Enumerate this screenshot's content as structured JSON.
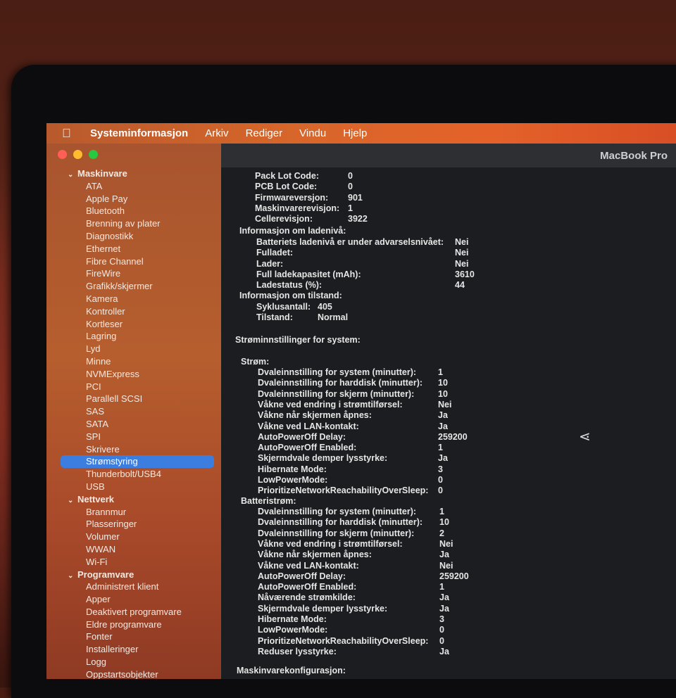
{
  "menubar": {
    "app_name": "Systeminformasjon",
    "items": [
      "Arkiv",
      "Rediger",
      "Vindu",
      "Hjelp"
    ]
  },
  "window": {
    "title": "MacBook Pro"
  },
  "sidebar": {
    "groups": [
      {
        "label": "Maskinvare",
        "items": [
          "ATA",
          "Apple Pay",
          "Bluetooth",
          "Brenning av plater",
          "Diagnostikk",
          "Ethernet",
          "Fibre Channel",
          "FireWire",
          "Grafikk/skjermer",
          "Kamera",
          "Kontroller",
          "Kortleser",
          "Lagring",
          "Lyd",
          "Minne",
          "NVMExpress",
          "PCI",
          "Parallell SCSI",
          "SAS",
          "SATA",
          "SPI",
          "Skrivere",
          "Strømstyring",
          "Thunderbolt/USB4",
          "USB"
        ]
      },
      {
        "label": "Nettverk",
        "items": [
          "Brannmur",
          "Plasseringer",
          "Volumer",
          "WWAN",
          "Wi-Fi"
        ]
      },
      {
        "label": "Programvare",
        "items": [
          "Administrert klient",
          "Apper",
          "Deaktivert programvare",
          "Eldre programvare",
          "Fonter",
          "Installeringer",
          "Logg",
          "Oppstartsobjekter"
        ]
      }
    ],
    "selected": "Strømstyring"
  },
  "content": {
    "battery_model": [
      {
        "label": "Pack Lot Code:",
        "value": "0"
      },
      {
        "label": "PCB Lot Code:",
        "value": "0"
      },
      {
        "label": "Firmwareversjon:",
        "value": "901"
      },
      {
        "label": "Maskinvarerevisjon:",
        "value": "1"
      },
      {
        "label": "Cellerevisjon:",
        "value": "3922"
      }
    ],
    "charge_header": "Informasjon om ladenivå:",
    "charge": [
      {
        "label": "Batteriets ladenivå er under advarselsnivået:",
        "value": "Nei"
      },
      {
        "label": "Fulladet:",
        "value": "Nei"
      },
      {
        "label": "Lader:",
        "value": "Nei"
      },
      {
        "label": "Full ladekapasitet (mAh):",
        "value": "3610"
      },
      {
        "label": "Ladestatus (%):",
        "value": "44"
      }
    ],
    "health_header": "Informasjon om tilstand:",
    "health": [
      {
        "label": "Syklusantall:",
        "value": "405"
      },
      {
        "label": "Tilstand:",
        "value": "Normal"
      }
    ],
    "system_header": "Strøminnstillinger for system:",
    "ac_header": "Strøm:",
    "ac": [
      {
        "label": "Dvaleinnstilling for system (minutter):",
        "value": "1"
      },
      {
        "label": "Dvaleinnstilling for harddisk (minutter):",
        "value": "10"
      },
      {
        "label": "Dvaleinnstilling for skjerm (minutter):",
        "value": "10"
      },
      {
        "label": "Våkne ved endring i strømtilførsel:",
        "value": "Nei"
      },
      {
        "label": "Våkne når skjermen åpnes:",
        "value": "Ja"
      },
      {
        "label": "Våkne ved LAN-kontakt:",
        "value": "Ja"
      },
      {
        "label": "AutoPowerOff Delay:",
        "value": "259200"
      },
      {
        "label": "AutoPowerOff Enabled:",
        "value": "1"
      },
      {
        "label": "Skjermdvale demper lysstyrke:",
        "value": "Ja"
      },
      {
        "label": "Hibernate Mode:",
        "value": "3"
      },
      {
        "label": "LowPowerMode:",
        "value": "0"
      },
      {
        "label": "PrioritizeNetworkReachabilityOverSleep:",
        "value": "0"
      }
    ],
    "battery_header": "Batteristrøm:",
    "battery": [
      {
        "label": "Dvaleinnstilling for system (minutter):",
        "value": "1"
      },
      {
        "label": "Dvaleinnstilling for harddisk (minutter):",
        "value": "10"
      },
      {
        "label": "Dvaleinnstilling for skjerm (minutter):",
        "value": "2"
      },
      {
        "label": "Våkne ved endring i strømtilførsel:",
        "value": "Nei"
      },
      {
        "label": "Våkne når skjermen åpnes:",
        "value": "Ja"
      },
      {
        "label": "Våkne ved LAN-kontakt:",
        "value": "Nei"
      },
      {
        "label": "AutoPowerOff Delay:",
        "value": "259200"
      },
      {
        "label": "AutoPowerOff Enabled:",
        "value": "1"
      },
      {
        "label": "Nåværende strømkilde:",
        "value": "Ja"
      },
      {
        "label": "Skjermdvale demper lysstyrke:",
        "value": "Ja"
      },
      {
        "label": "Hibernate Mode:",
        "value": "3"
      },
      {
        "label": "LowPowerMode:",
        "value": "0"
      },
      {
        "label": "PrioritizeNetworkReachabilityOverSleep:",
        "value": "0"
      },
      {
        "label": "Reduser lysstyrke:",
        "value": "Ja"
      }
    ],
    "config_header": "Maskinvarekonfigurasjon:"
  }
}
